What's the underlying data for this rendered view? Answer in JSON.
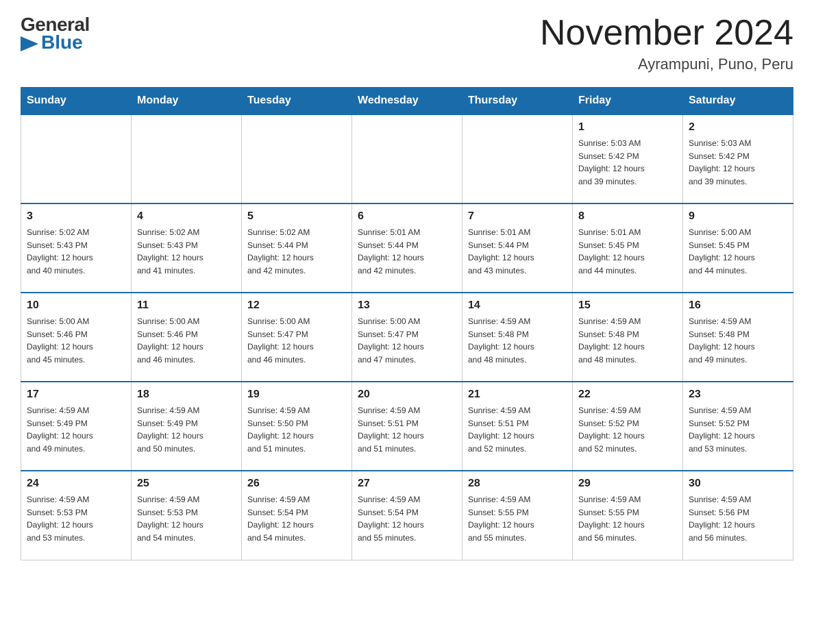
{
  "logo": {
    "general": "General",
    "blue": "Blue",
    "arrow": "▶"
  },
  "title": "November 2024",
  "subtitle": "Ayrampuni, Puno, Peru",
  "days_of_week": [
    "Sunday",
    "Monday",
    "Tuesday",
    "Wednesday",
    "Thursday",
    "Friday",
    "Saturday"
  ],
  "weeks": [
    [
      {
        "day": "",
        "info": ""
      },
      {
        "day": "",
        "info": ""
      },
      {
        "day": "",
        "info": ""
      },
      {
        "day": "",
        "info": ""
      },
      {
        "day": "",
        "info": ""
      },
      {
        "day": "1",
        "info": "Sunrise: 5:03 AM\nSunset: 5:42 PM\nDaylight: 12 hours\nand 39 minutes."
      },
      {
        "day": "2",
        "info": "Sunrise: 5:03 AM\nSunset: 5:42 PM\nDaylight: 12 hours\nand 39 minutes."
      }
    ],
    [
      {
        "day": "3",
        "info": "Sunrise: 5:02 AM\nSunset: 5:43 PM\nDaylight: 12 hours\nand 40 minutes."
      },
      {
        "day": "4",
        "info": "Sunrise: 5:02 AM\nSunset: 5:43 PM\nDaylight: 12 hours\nand 41 minutes."
      },
      {
        "day": "5",
        "info": "Sunrise: 5:02 AM\nSunset: 5:44 PM\nDaylight: 12 hours\nand 42 minutes."
      },
      {
        "day": "6",
        "info": "Sunrise: 5:01 AM\nSunset: 5:44 PM\nDaylight: 12 hours\nand 42 minutes."
      },
      {
        "day": "7",
        "info": "Sunrise: 5:01 AM\nSunset: 5:44 PM\nDaylight: 12 hours\nand 43 minutes."
      },
      {
        "day": "8",
        "info": "Sunrise: 5:01 AM\nSunset: 5:45 PM\nDaylight: 12 hours\nand 44 minutes."
      },
      {
        "day": "9",
        "info": "Sunrise: 5:00 AM\nSunset: 5:45 PM\nDaylight: 12 hours\nand 44 minutes."
      }
    ],
    [
      {
        "day": "10",
        "info": "Sunrise: 5:00 AM\nSunset: 5:46 PM\nDaylight: 12 hours\nand 45 minutes."
      },
      {
        "day": "11",
        "info": "Sunrise: 5:00 AM\nSunset: 5:46 PM\nDaylight: 12 hours\nand 46 minutes."
      },
      {
        "day": "12",
        "info": "Sunrise: 5:00 AM\nSunset: 5:47 PM\nDaylight: 12 hours\nand 46 minutes."
      },
      {
        "day": "13",
        "info": "Sunrise: 5:00 AM\nSunset: 5:47 PM\nDaylight: 12 hours\nand 47 minutes."
      },
      {
        "day": "14",
        "info": "Sunrise: 4:59 AM\nSunset: 5:48 PM\nDaylight: 12 hours\nand 48 minutes."
      },
      {
        "day": "15",
        "info": "Sunrise: 4:59 AM\nSunset: 5:48 PM\nDaylight: 12 hours\nand 48 minutes."
      },
      {
        "day": "16",
        "info": "Sunrise: 4:59 AM\nSunset: 5:48 PM\nDaylight: 12 hours\nand 49 minutes."
      }
    ],
    [
      {
        "day": "17",
        "info": "Sunrise: 4:59 AM\nSunset: 5:49 PM\nDaylight: 12 hours\nand 49 minutes."
      },
      {
        "day": "18",
        "info": "Sunrise: 4:59 AM\nSunset: 5:49 PM\nDaylight: 12 hours\nand 50 minutes."
      },
      {
        "day": "19",
        "info": "Sunrise: 4:59 AM\nSunset: 5:50 PM\nDaylight: 12 hours\nand 51 minutes."
      },
      {
        "day": "20",
        "info": "Sunrise: 4:59 AM\nSunset: 5:51 PM\nDaylight: 12 hours\nand 51 minutes."
      },
      {
        "day": "21",
        "info": "Sunrise: 4:59 AM\nSunset: 5:51 PM\nDaylight: 12 hours\nand 52 minutes."
      },
      {
        "day": "22",
        "info": "Sunrise: 4:59 AM\nSunset: 5:52 PM\nDaylight: 12 hours\nand 52 minutes."
      },
      {
        "day": "23",
        "info": "Sunrise: 4:59 AM\nSunset: 5:52 PM\nDaylight: 12 hours\nand 53 minutes."
      }
    ],
    [
      {
        "day": "24",
        "info": "Sunrise: 4:59 AM\nSunset: 5:53 PM\nDaylight: 12 hours\nand 53 minutes."
      },
      {
        "day": "25",
        "info": "Sunrise: 4:59 AM\nSunset: 5:53 PM\nDaylight: 12 hours\nand 54 minutes."
      },
      {
        "day": "26",
        "info": "Sunrise: 4:59 AM\nSunset: 5:54 PM\nDaylight: 12 hours\nand 54 minutes."
      },
      {
        "day": "27",
        "info": "Sunrise: 4:59 AM\nSunset: 5:54 PM\nDaylight: 12 hours\nand 55 minutes."
      },
      {
        "day": "28",
        "info": "Sunrise: 4:59 AM\nSunset: 5:55 PM\nDaylight: 12 hours\nand 55 minutes."
      },
      {
        "day": "29",
        "info": "Sunrise: 4:59 AM\nSunset: 5:55 PM\nDaylight: 12 hours\nand 56 minutes."
      },
      {
        "day": "30",
        "info": "Sunrise: 4:59 AM\nSunset: 5:56 PM\nDaylight: 12 hours\nand 56 minutes."
      }
    ]
  ]
}
